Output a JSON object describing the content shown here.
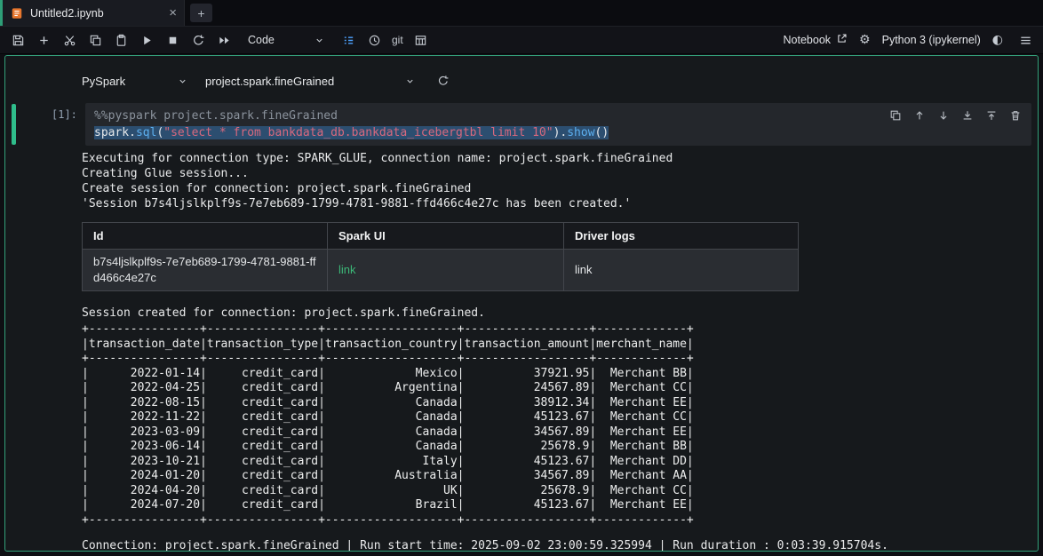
{
  "colors": {
    "accent_green": "#33a07a",
    "cell_indicator_green": "#2fbd8b",
    "link_green": "#3cb878",
    "toc_icon_blue": "#4da3ff",
    "selection_blue": "#2c4e70",
    "string_red": "#d8697e",
    "function_blue": "#5db0f0",
    "notebook_icon_orange": "#e8772e"
  },
  "icons": {
    "close": "×",
    "new_tab": "+",
    "gear": "⚙",
    "kernel_status": "◐"
  },
  "tab_bar": {
    "active_tab": "Untitled2.ipynb"
  },
  "toolbar": {
    "cell_type_label": "Code",
    "git_label": "git",
    "notebook_label": "Notebook",
    "kernel_label": "Python 3 (ipykernel)"
  },
  "connection_bar": {
    "language": "PySpark",
    "connection": "project.spark.fineGrained"
  },
  "cell": {
    "prompt": "[1]:",
    "line1": "%%pyspark project.spark.fineGrained",
    "line2": {
      "p1": "spark.",
      "fn1": "sql",
      "p2": "(",
      "str": "\"select * from bankdata_db.bankdata_icebergtbl limit 10\"",
      "p3": ").",
      "fn2": "show",
      "p4": "()"
    }
  },
  "output": {
    "lines": [
      "Executing for connection type: SPARK_GLUE, connection name: project.spark.fineGrained",
      "Creating Glue session...",
      "Create session for connection: project.spark.fineGrained",
      "'Session b7s4ljslkplf9s-7e7eb689-1799-4781-9881-ffd466c4e27c has been created.'"
    ],
    "session_created": "Session created for connection: project.spark.fineGrained.",
    "footer": "Connection: project.spark.fineGrained | Run start time: 2025-09-02 23:00:59.325994 | Run duration : 0:03:39.915704s."
  },
  "session_table": {
    "columns": [
      "Id",
      "Spark UI",
      "Driver logs"
    ],
    "row": {
      "id": "b7s4ljslkplf9s-7e7eb689-1799-4781-9881-ffd466c4e27c",
      "spark_ui_link": "link",
      "driver_logs_link": "link"
    }
  },
  "result_table": {
    "headers": [
      "transaction_date",
      "transaction_type",
      "transaction_country",
      "transaction_amount",
      "merchant_name"
    ],
    "widths": [
      16,
      16,
      19,
      18,
      13
    ],
    "rows": [
      [
        "2022-01-14",
        "credit_card",
        "Mexico",
        "37921.95",
        "Merchant BB"
      ],
      [
        "2022-04-25",
        "credit_card",
        "Argentina",
        "24567.89",
        "Merchant CC"
      ],
      [
        "2022-08-15",
        "credit_card",
        "Canada",
        "38912.34",
        "Merchant EE"
      ],
      [
        "2022-11-22",
        "credit_card",
        "Canada",
        "45123.67",
        "Merchant CC"
      ],
      [
        "2023-03-09",
        "credit_card",
        "Canada",
        "34567.89",
        "Merchant EE"
      ],
      [
        "2023-06-14",
        "credit_card",
        "Canada",
        "25678.9",
        "Merchant BB"
      ],
      [
        "2023-10-21",
        "credit_card",
        "Italy",
        "45123.67",
        "Merchant DD"
      ],
      [
        "2024-01-20",
        "credit_card",
        "Australia",
        "34567.89",
        "Merchant AA"
      ],
      [
        "2024-04-20",
        "credit_card",
        "UK",
        "25678.9",
        "Merchant CC"
      ],
      [
        "2024-07-20",
        "credit_card",
        "Brazil",
        "45123.67",
        "Merchant EE"
      ]
    ]
  }
}
